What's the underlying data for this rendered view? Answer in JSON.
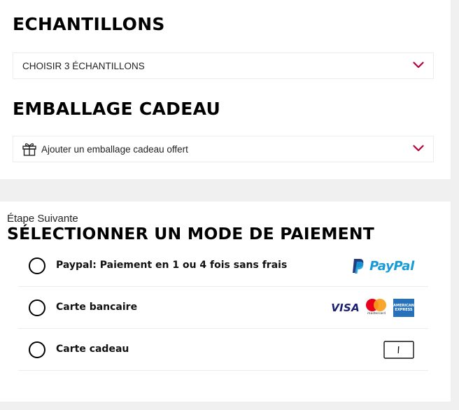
{
  "samples": {
    "heading": "ECHANTILLONS",
    "select_label": "CHOISIR 3 ÉCHANTILLONS",
    "chevron_icon": "chevron-down-icon"
  },
  "gift_wrap": {
    "heading": "EMBALLAGE CADEAU",
    "select_label": "Ajouter un emballage cadeau offert",
    "icon": "gift-icon",
    "chevron_icon": "chevron-down-icon"
  },
  "payment": {
    "step_label": "Étape Suivante",
    "title": "SÉLECTIONNER UN MODE DE PAIEMENT",
    "options": [
      {
        "label": "Paypal: Paiement en 1 ou 4 fois sans frais",
        "logos": [
          "paypal-logo"
        ],
        "logo_text": "PayPal",
        "selected": false
      },
      {
        "label": "Carte bancaire",
        "logos": [
          "visa-logo",
          "mastercard-logo",
          "amex-logo"
        ],
        "visa_text": "VISA",
        "mastercard_text": "mastercard",
        "amex_text_1": "AMERICAN",
        "amex_text_2": "EXPRESS",
        "selected": false
      },
      {
        "label": "Carte cadeau",
        "logos": [
          "gift-card-icon"
        ],
        "selected": false
      }
    ]
  },
  "colors": {
    "accent": "#b8003a",
    "background": "#f0f0f0",
    "paypal_dark": "#253b80",
    "paypal_light": "#179bd7",
    "amex_blue": "#2671b9",
    "mastercard_red": "#eb001b",
    "mastercard_yellow": "#f79e1b"
  }
}
